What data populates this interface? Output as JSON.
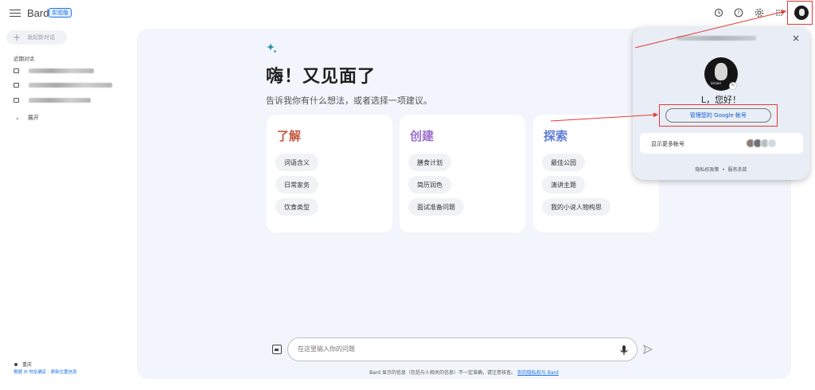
{
  "header": {
    "app_name": "Bard",
    "badge": "实验版",
    "icons": [
      "history-icon",
      "help-icon",
      "settings-icon",
      "apps-icon"
    ]
  },
  "sidebar": {
    "new_chat": "发起新对话",
    "recent_title": "近期对话",
    "expand": "展开",
    "location_name": "重庆",
    "location_link": "根据 IP 地址确定 · 更新位置信息"
  },
  "main": {
    "greeting": "嗨！又见面了",
    "subtext": "告诉我你有什么想法，或者选择一项建议。",
    "cards": [
      {
        "title": "了解",
        "color": "#c5553e",
        "chips": [
          "词语含义",
          "日常家务",
          "饮食类型"
        ]
      },
      {
        "title": "创建",
        "color": "#9c6fcc",
        "chips": [
          "膳食计划",
          "简历润色",
          "面试准备问题"
        ]
      },
      {
        "title": "探索",
        "color": "#5b7bd5",
        "chips": [
          "最佳公园",
          "演讲主题",
          "我的小说人物构思"
        ]
      }
    ],
    "input_placeholder": "在这里输入你的问题",
    "disclaimer": "Bard 显示的信息（包括与人相关的信息）不一定准确，请注意核查。",
    "disclaimer_link": "你的隐私权与 Bard"
  },
  "account_popup": {
    "hello": "L，您好！",
    "avatar_tag": "Lilcael",
    "manage_button": "管理您的 Google 帐号",
    "more_accounts": "显示更多帐号",
    "privacy": "隐私权政策",
    "separator": "•",
    "terms": "服务条款",
    "close": "×"
  }
}
